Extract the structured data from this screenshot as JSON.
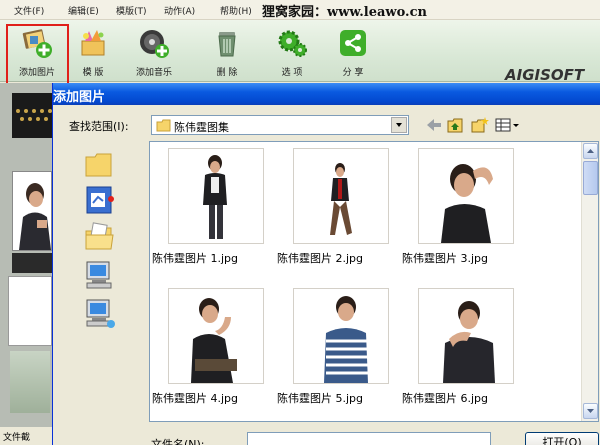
{
  "menu": [
    "文件(F)",
    "编辑(E)",
    "模版(T)",
    "动作(A)",
    "帮助(H)"
  ],
  "watermark": "狸窝家园：www.leawo.cn",
  "toolbar": {
    "add_image": "添加图片",
    "template": "模 版",
    "add_music": "添加音乐",
    "delete": "删 除",
    "options": "选 项",
    "share": "分 享"
  },
  "logo": "AIGISOFT",
  "left_status": "文件截",
  "dialog": {
    "title": "添加图片",
    "look_in_label": "查找范围(I):",
    "look_in_value": "陈伟霆图集",
    "filename_label": "文件名(N):",
    "filename_value": "",
    "open_label": "打开(O)"
  },
  "files": [
    {
      "name": "陈伟霆图片 1.jpg"
    },
    {
      "name": "陈伟霆图片 2.jpg"
    },
    {
      "name": "陈伟霆图片 3.jpg"
    },
    {
      "name": "陈伟霆图片 4.jpg"
    },
    {
      "name": "陈伟霆图片 5.jpg"
    },
    {
      "name": "陈伟霆图片 6.jpg"
    }
  ],
  "colors": {
    "title_bar": "#0a5ae0",
    "highlight_box": "#e0201a",
    "toolbar_bg": "#d9e8d6"
  },
  "icons": [
    "add-image-icon",
    "template-icon",
    "add-music-icon",
    "trash-icon",
    "options-gear-icon",
    "share-icon"
  ]
}
